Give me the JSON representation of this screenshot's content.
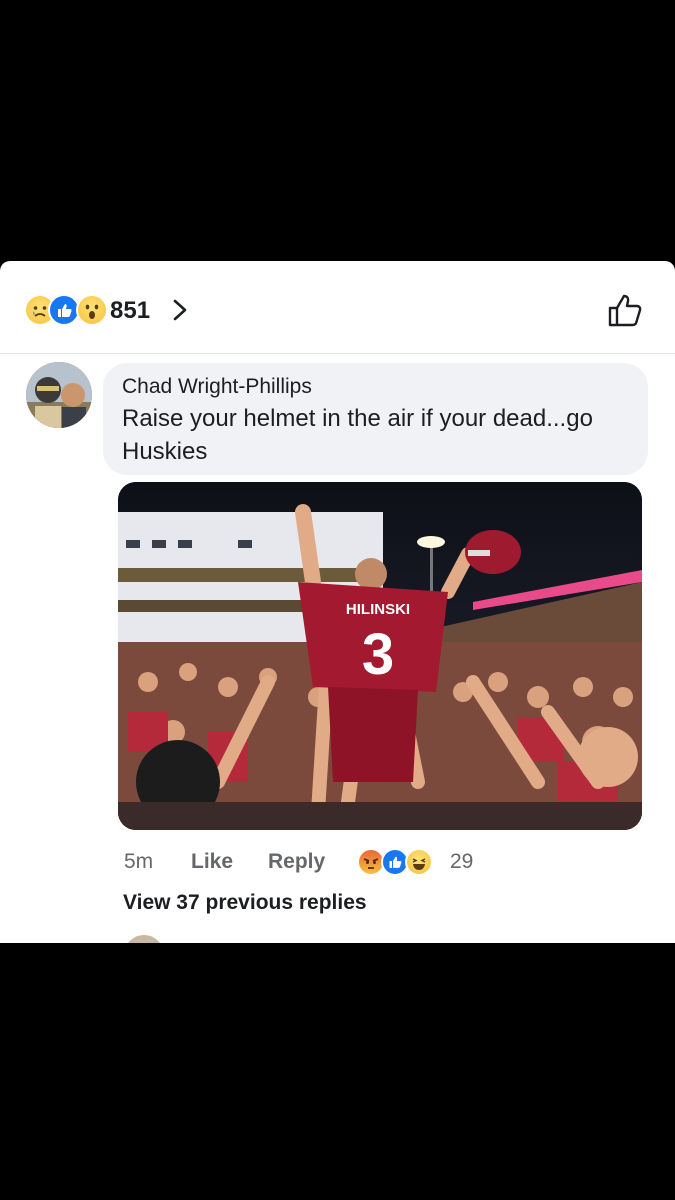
{
  "post": {
    "reaction_count": "851",
    "reaction_types": [
      "sad-emoji",
      "like-emoji",
      "wow-emoji"
    ],
    "like_button_icon": "thumbs-up-outline-icon"
  },
  "comment": {
    "author": "Chad Wright-Phillips",
    "text": "Raise your helmet in the air if your dead...go Huskies",
    "photo": {
      "jersey_name": "HILINSKI",
      "jersey_number": "3"
    },
    "time": "5m",
    "like_label": "Like",
    "reply_label": "Reply",
    "reaction_types": [
      "angry-emoji",
      "like-emoji",
      "haha-emoji"
    ],
    "reaction_count": "29"
  },
  "view_previous_replies": "View 37 previous replies",
  "colors": {
    "like_blue": "#1877f2",
    "bubble_bg": "#f0f2f5",
    "meta_gray": "#65676b",
    "jersey_red": "#a3192f"
  }
}
